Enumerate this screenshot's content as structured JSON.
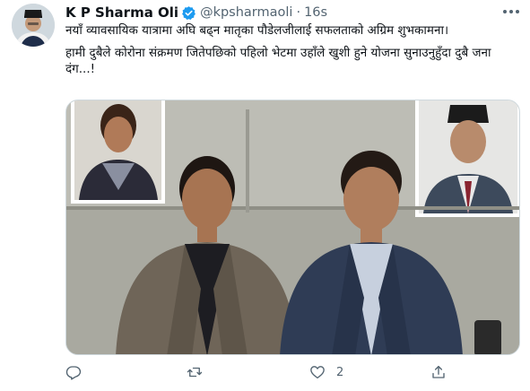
{
  "tweet": {
    "display_name": "K P Sharma Oli",
    "handle": "@kpsharmaoli",
    "separator": "·",
    "time": "16s",
    "text_line1": "नयाँ व्यावसायिक यात्रामा अघि बढ्न मातृका पौडेलजीलाई सफलताको अग्रिम शुभकामना।",
    "text_line2": "हामी दुबैले कोरोना संक्रमण जितेपछिको पहिलो भेटमा उहाँले खुशी हुने योजना सुनाउनुहुँदा दुबै जना दंग...!",
    "like_count": "2"
  },
  "icons": {
    "verified": "verified-badge-icon",
    "more": "more-options-icon",
    "reply": "reply-icon",
    "retweet": "retweet-icon",
    "like": "like-heart-icon",
    "share": "share-icon"
  },
  "colors": {
    "verified_blue": "#1d9bf0",
    "muted": "#536471",
    "text": "#0f1419",
    "border": "#cfd9de"
  }
}
